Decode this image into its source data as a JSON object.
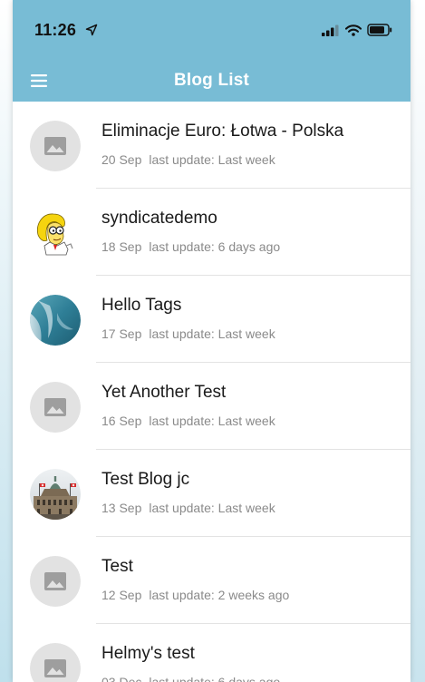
{
  "status_bar": {
    "time": "11:26"
  },
  "nav": {
    "title": "Blog List",
    "bar_color": "#78bcd5"
  },
  "blogs": [
    {
      "title": "Eliminacje Euro: Łotwa - Polska",
      "date": "20 Sep",
      "update_label": "last update:",
      "updated": "Last week",
      "avatar": "placeholder-image-icon"
    },
    {
      "title": "syndicatedemo",
      "date": "18 Sep",
      "update_label": "last update:",
      "updated": "6 days ago",
      "avatar": "cartoon-character-avatar"
    },
    {
      "title": "Hello Tags",
      "date": "17 Sep",
      "update_label": "last update:",
      "updated": "Last week",
      "avatar": "ocean-photo-avatar"
    },
    {
      "title": "Yet Another Test",
      "date": "16 Sep",
      "update_label": "last update:",
      "updated": "Last week",
      "avatar": "placeholder-image-icon"
    },
    {
      "title": "Test Blog jc",
      "date": "13 Sep",
      "update_label": "last update:",
      "updated": "Last week",
      "avatar": "building-photo-avatar"
    },
    {
      "title": "Test",
      "date": "12 Sep",
      "update_label": "last update:",
      "updated": "2 weeks ago",
      "avatar": "placeholder-image-icon"
    },
    {
      "title": "Helmy's test",
      "date": "03 Dec",
      "update_label": "last update:",
      "updated": "6 days ago",
      "avatar": "placeholder-image-icon"
    }
  ]
}
